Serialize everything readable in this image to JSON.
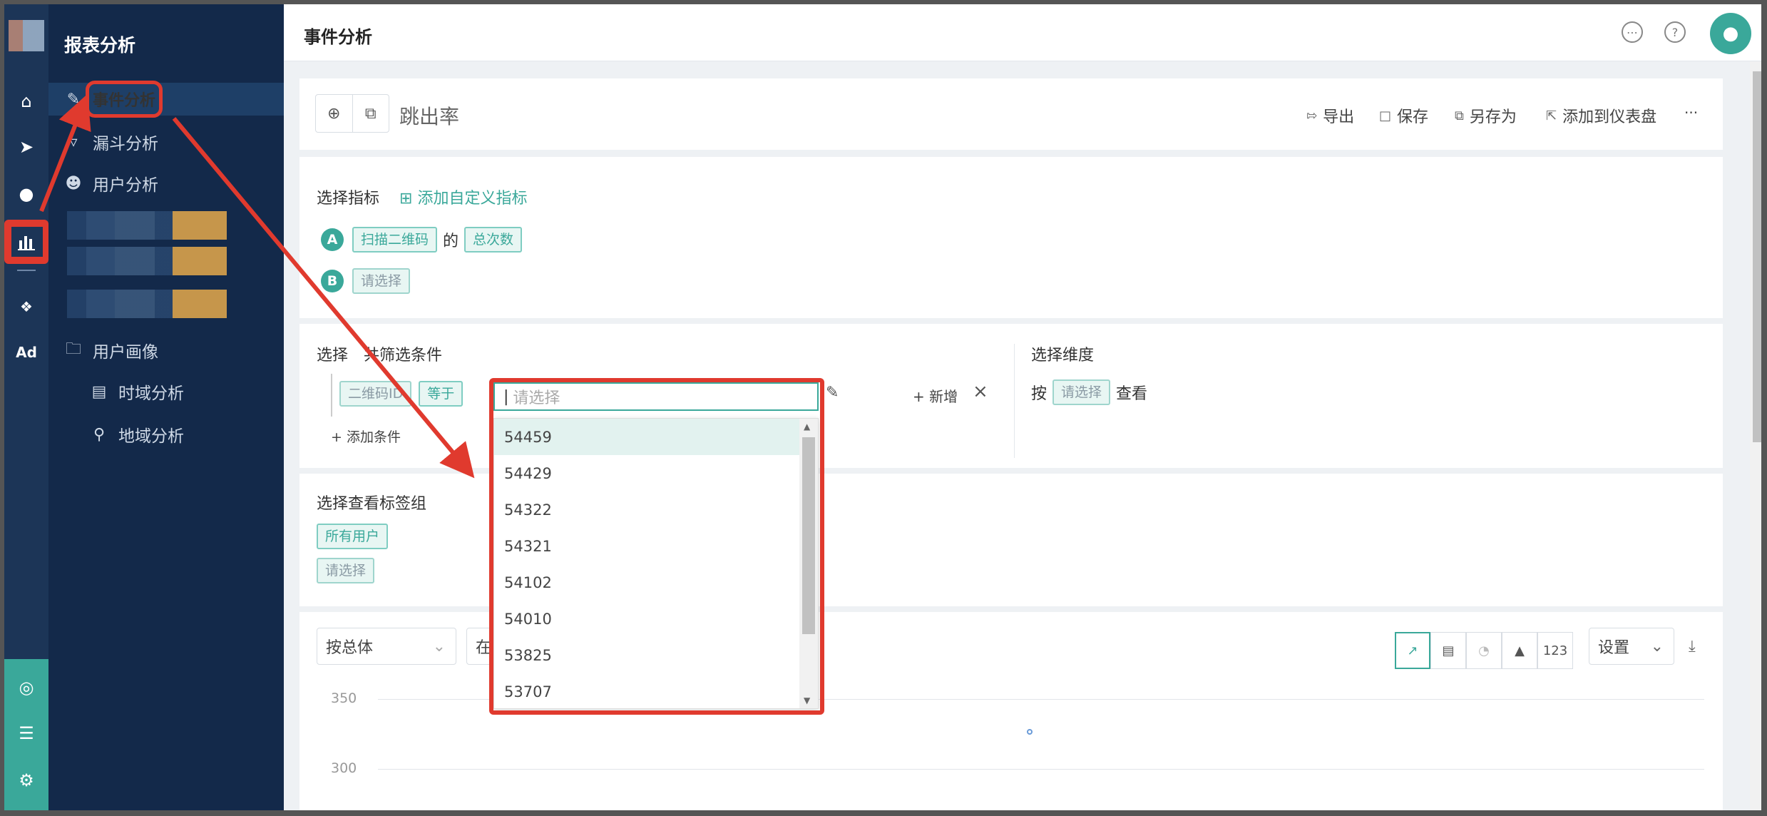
{
  "app": {
    "menu_title": "报表分析",
    "page_title": "事件分析"
  },
  "rail_icons": [
    "home-icon",
    "send-icon",
    "user-icon",
    "bar-chart-icon",
    "wechat-icon",
    "ad-icon",
    "target-icon",
    "server-icon",
    "gear-icon"
  ],
  "rail_ad_label": "Ad",
  "menu": {
    "items": [
      {
        "label": "事件分析",
        "icon": "edit-icon",
        "active": true
      },
      {
        "label": "漏斗分析",
        "icon": "funnel-icon"
      },
      {
        "label": "用户分析",
        "icon": "user-outline-icon"
      },
      {
        "label": "用户画像",
        "icon": "folder-icon"
      },
      {
        "label": "时域分析",
        "icon": "bar-chart-outline-icon"
      },
      {
        "label": "地域分析",
        "icon": "location-icon"
      }
    ]
  },
  "toolbar": {
    "report_name": "跳出率",
    "export": "导出",
    "save": "保存",
    "save_as": "另存为",
    "add_to_dashboard": "添加到仪表盘",
    "more": "···"
  },
  "metrics": {
    "label": "选择指标",
    "add_custom": "添加自定义指标",
    "a_badge": "A",
    "a_event": "扫描二维码",
    "a_of": "的",
    "a_measure": "总次数",
    "b_badge": "B",
    "b_placeholder": "请选择"
  },
  "filters": {
    "label": "选择",
    "label_rest": "共筛选条件",
    "field": "二维码ID",
    "operator": "等于",
    "add_new": "+ 新增",
    "add_condition": "+ 添加条件",
    "value_placeholder": "请选择"
  },
  "dimension": {
    "label": "选择维度",
    "by": "按",
    "placeholder": "请选择",
    "view": "查看"
  },
  "tags": {
    "label": "选择查看标签组",
    "all_users": "所有用户",
    "placeholder": "请选择"
  },
  "dropdown_options": [
    "54459",
    "54429",
    "54322",
    "54321",
    "54102",
    "54010",
    "53825",
    "53707"
  ],
  "chart_controls": {
    "group_by": "按总体",
    "second_select": "在",
    "settings": "设置",
    "number_btn": "123"
  },
  "chart_data": {
    "type": "line",
    "y_ticks": [
      "350",
      "300"
    ],
    "series": [],
    "x": []
  }
}
